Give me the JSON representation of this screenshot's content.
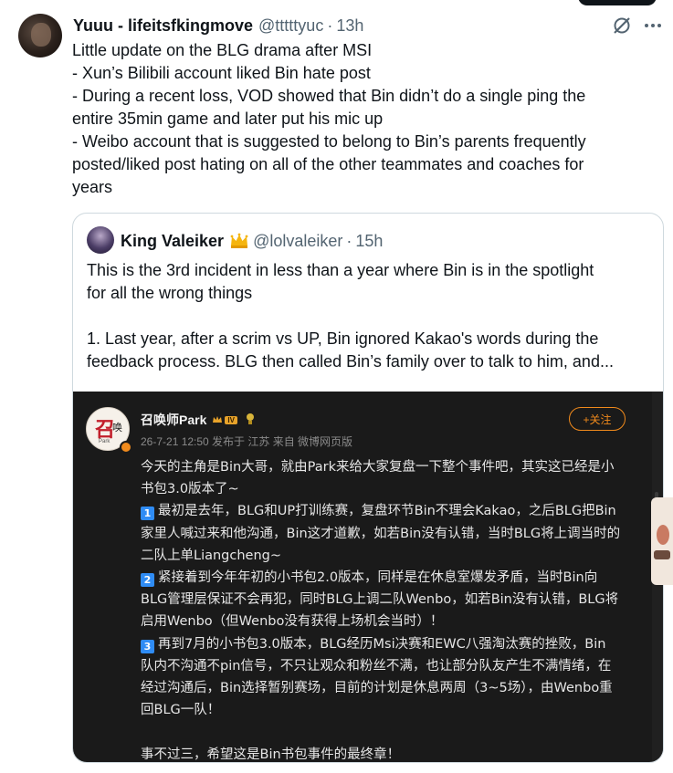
{
  "author": {
    "name": "Yuuu - lifeitsfkingmove",
    "handle": "@tttttyuc",
    "separator": "·",
    "time": "13h"
  },
  "tweet_lines": [
    "Little update on the BLG drama after MSI",
    "- Xun’s Bilibili account liked Bin hate post",
    "- During a recent loss, VOD showed that Bin didn’t do a single ping the",
    "entire 35min game and later put his mic up",
    "- Weibo account that is suggested to belong to Bin’s parents frequently",
    "posted/liked post hating on all of the other teammates and coaches for",
    "years"
  ],
  "quote": {
    "name": "King Valeiker",
    "crown_icon": "crown-icon",
    "handle": "@lolvaleiker",
    "separator": "·",
    "time": "15h",
    "lines": [
      "This is the 3rd incident in less than a year where Bin is in the spotlight",
      "for all the wrong things",
      "1. Last year, after a scrim vs UP, Bin ignored Kakao's words during the",
      "feedback process. BLG then called Bin’s family over to talk to him, and..."
    ]
  },
  "media": {
    "avatar_logo": "召",
    "avatar_logo2": "唤",
    "avatar_sub": "Park",
    "name": "召唤师Park",
    "level": "IV",
    "meta": "26-7-21 12:50 发布于 江苏 来自 微博网页版",
    "follow_label": "+关注",
    "intro_lines": [
      "今天的主角是Bin大哥，就由Park来给大家复盘一下整个事件吧，其实这已经是小",
      "书包3.0版本了~"
    ],
    "points": [
      {
        "num": "1",
        "lines": [
          "最初是去年，BLG和UP打训练赛，复盘环节Bin不理会Kakao，之后BLG把Bin",
          "家里人喊过来和他沟通，Bin这才道歉，如若Bin没有认错，当时BLG将上调当时的",
          "二队上单Liangcheng~"
        ]
      },
      {
        "num": "2",
        "lines": [
          "紧接着到今年年初的小书包2.0版本，同样是在休息室爆发矛盾，当时Bin向",
          "BLG管理层保证不会再犯，同时BLG上调二队Wenbo，如若Bin没有认错，BLG将",
          "启用Wenbo（但Wenbo没有获得上场机会当时）！"
        ]
      },
      {
        "num": "3",
        "lines": [
          "再到7月的小书包3.0版本，BLG经历Msi决赛和EWC八强淘汰赛的挫败，Bin",
          "队内不沟通不pin信号，不只让观众和粉丝不满，也让部分队友产生不满情绪，在",
          "经过沟通后，Bin选择暂别赛场，目前的计划是休息两周（3~5场），由Wenbo重",
          "回BLG一队！"
        ]
      }
    ],
    "closing": "事不过三，希望这是Bin书包事件的最终章！"
  },
  "colors": {
    "text": "#0f1419",
    "muted": "#536471",
    "border": "#cfd9de",
    "media_bg": "#1a1a1a",
    "weibo_orange": "#f08a1c",
    "number_badge": "#2f8cf5"
  }
}
